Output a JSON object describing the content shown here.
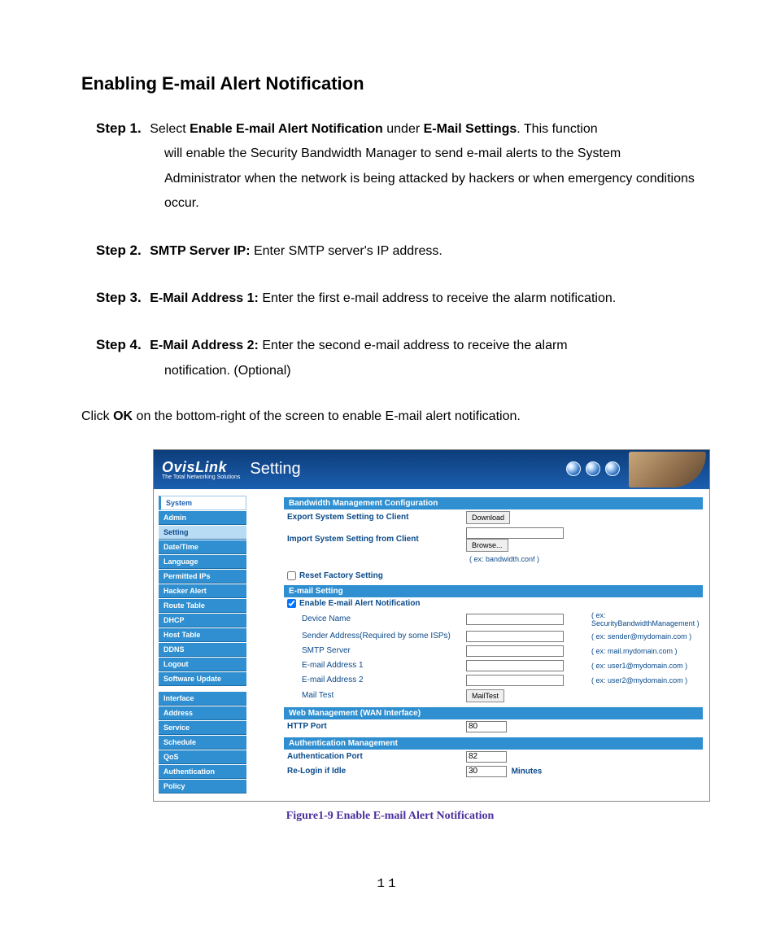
{
  "page": {
    "title": "Enabling E-mail Alert Notification",
    "click_ok_pre": "Click ",
    "click_ok_bold": "OK",
    "click_ok_post": " on the bottom-right of the screen to enable E-mail alert notification.",
    "page_number": "11"
  },
  "steps": [
    {
      "label": "Step 1.",
      "pre": "Select ",
      "bold1": "Enable E-mail Alert Notification",
      "mid": " under ",
      "bold2": "E-Mail Settings",
      "post_inline": ". This function",
      "cont": "will enable the Security Bandwidth Manager to send e-mail alerts to the System Administrator when the network is being attacked by hackers or when emergency conditions occur."
    },
    {
      "label": "Step 2.",
      "bold1": "SMTP Server IP:",
      "post_inline": " Enter SMTP server's IP address."
    },
    {
      "label": "Step 3.",
      "bold1": "E-Mail Address 1:",
      "post_inline": " Enter the first e-mail address to receive the alarm notification."
    },
    {
      "label": "Step 4.",
      "bold1": "E-Mail Address 2:",
      "post_inline": " Enter the second e-mail address to receive the alarm",
      "cont": "notification. (Optional)"
    }
  ],
  "figure": {
    "brand": "OvisLink",
    "tagline": "The Total Networking Solutions",
    "header_title": "Setting",
    "sidebar": {
      "system": "System",
      "items_top": [
        "Admin",
        "Setting",
        "Date/Time",
        "Language",
        "Permitted IPs",
        "Hacker Alert",
        "Route Table",
        "DHCP",
        "Host Table",
        "DDNS",
        "Logout",
        "Software Update"
      ],
      "items_bottom": [
        "Interface",
        "Address",
        "Service",
        "Schedule",
        "QoS",
        "Authentication",
        "Policy"
      ]
    },
    "sections": {
      "bw_title": "Bandwidth Management Configuration",
      "export_label": "Export System Setting to Client",
      "download_btn": "Download",
      "import_label": "Import System Setting from Client",
      "browse_btn": "Browse...",
      "import_hint": "( ex: bandwidth.conf )",
      "reset_label": "Reset Factory Setting",
      "email_title": "E-mail Setting",
      "enable_label": "Enable E-mail Alert Notification",
      "device_label": "Device Name",
      "device_hint": "( ex: SecurityBandwidthManagement )",
      "sender_label": "Sender Address(Required by some ISPs)",
      "sender_hint": "( ex: sender@mydomain.com )",
      "smtp_label": "SMTP Server",
      "smtp_hint": "( ex: mail.mydomain.com )",
      "email1_label": "E-mail Address 1",
      "email1_hint": "( ex: user1@mydomain.com )",
      "email2_label": "E-mail Address 2",
      "email2_hint": "( ex: user2@mydomain.com )",
      "mailtest_label": "Mail Test",
      "mailtest_btn": "MailTest",
      "web_title": "Web Management (WAN Interface)",
      "http_label": "HTTP Port",
      "http_value": "80",
      "auth_title": "Authentication Management",
      "authport_label": "Authentication Port",
      "authport_value": "82",
      "relogin_label": "Re-Login if Idle",
      "relogin_value": "30",
      "relogin_unit": "Minutes"
    },
    "caption": "Figure1-9 Enable E-mail Alert Notification"
  }
}
